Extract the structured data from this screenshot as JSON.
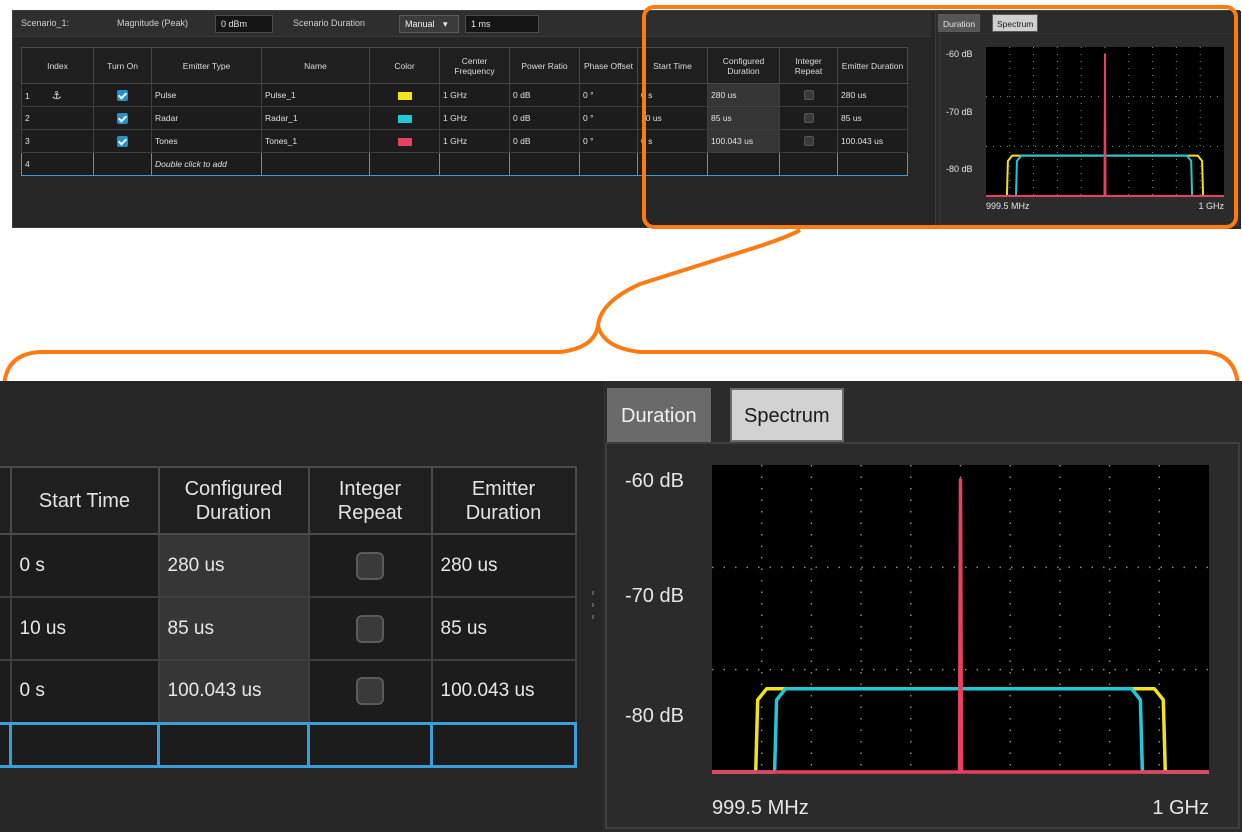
{
  "toolbar": {
    "scenario_label": "Scenario_1:",
    "magnitude_label": "Magnitude (Peak)",
    "magnitude_value": "0 dBm",
    "duration_label": "Scenario Duration",
    "duration_mode": "Manual",
    "duration_value": "1 ms"
  },
  "table": {
    "headers": {
      "index": "Index",
      "turn_on": "Turn On",
      "emitter_type": "Emitter Type",
      "name": "Name",
      "color": "Color",
      "center_frequency": "Center Frequency",
      "power_ratio": "Power Ratio",
      "phase_offset": "Phase Offset",
      "start_time": "Start Time",
      "configured_duration": "Configured Duration",
      "integer_repeat": "Integer Repeat",
      "emitter_duration": "Emitter Duration"
    },
    "rows": [
      {
        "index": "1",
        "type": "Pulse",
        "name": "Pulse_1",
        "color": "#f2e21a",
        "freq": "1 GHz",
        "power": "0 dB",
        "phase": "0 °",
        "start": "0 s",
        "configured": "280 us",
        "emitter_duration": "280 us"
      },
      {
        "index": "2",
        "type": "Radar",
        "name": "Radar_1",
        "color": "#22c8d8",
        "freq": "1 GHz",
        "power": "0 dB",
        "phase": "0 °",
        "start": "10 us",
        "configured": "85 us",
        "emitter_duration": "85 us"
      },
      {
        "index": "3",
        "type": "Tones",
        "name": "Tones_1",
        "color": "#e8415f",
        "freq": "1 GHz",
        "power": "0 dB",
        "phase": "0 °",
        "start": "0 s",
        "configured": "100.043 us",
        "emitter_duration": "100.043 us"
      }
    ],
    "add_row": {
      "index": "4",
      "hint": "Double click to add"
    }
  },
  "tabs": {
    "duration": "Duration",
    "spectrum": "Spectrum"
  },
  "chart_data": {
    "type": "line",
    "title": "",
    "xlabel": "",
    "ylabel": "",
    "x_tick_labels": [
      "999.5 MHz",
      "1 GHz"
    ],
    "y_tick_labels": [
      "-60 dB",
      "-70 dB",
      "-80 dB"
    ],
    "xlim": [
      999.5,
      1000.0
    ],
    "ylim": [
      -84.3,
      -59.6
    ],
    "grid": true,
    "series": [
      {
        "color": "#f2e21a",
        "x": [
          999.5,
          999.544,
          999.546,
          999.555,
          999.945,
          999.954,
          999.956,
          1000.0
        ],
        "y": [
          -84.3,
          -84.3,
          -78.5,
          -77.6,
          -77.6,
          -78.5,
          -84.3,
          -84.3
        ]
      },
      {
        "color": "#22c8d8",
        "x": [
          999.5,
          999.563,
          999.565,
          999.574,
          999.922,
          999.931,
          999.933,
          1000.0
        ],
        "y": [
          -84.3,
          -84.3,
          -78.5,
          -77.6,
          -77.6,
          -78.5,
          -84.3,
          -84.3
        ]
      },
      {
        "color": "#e8415f",
        "x": [
          999.5,
          999.749,
          999.749,
          999.75,
          999.75,
          999.751,
          999.751,
          1000.0
        ],
        "y": [
          -84.3,
          -84.3,
          -84.3,
          -60.8,
          -60.8,
          -84.3,
          -84.3,
          -84.3
        ]
      }
    ]
  }
}
